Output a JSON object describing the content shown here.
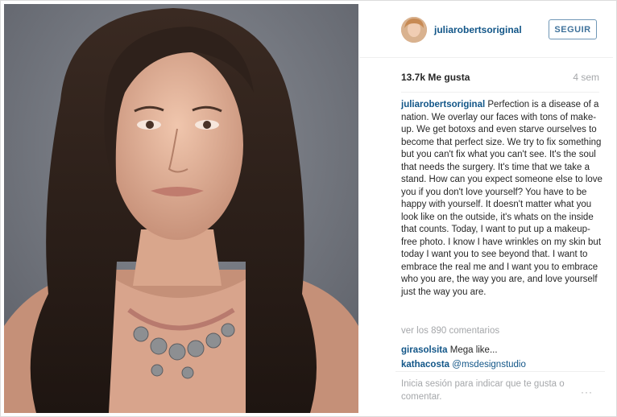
{
  "post": {
    "author": "juliarobertsoriginal",
    "follow_label": "SEGUIR",
    "likes": "13.7k Me gusta",
    "age": "4 sem",
    "caption_author": "juliarobertsoriginal",
    "caption_text": "Perfection is a disease of a nation. We overlay our faces with tons of make-up. We get botoxs and even starve ourselves to become that perfect size. We try to fix something but you can't fix what you can't see. It's the soul that needs the surgery. It's time that we take a stand. How can you expect someone else to love you if you don't love yourself? You have to be happy with yourself. It doesn't matter what you look like on the outside, it's whats on the inside that counts. Today, I want to put up a makeup-free photo. I know I have wrinkles on my skin but today I want you to see beyond that. I want to embrace the real me and I want you to embrace who you are, the way you are, and love yourself just the way you are.",
    "view_comments": "ver los 890 comentarios",
    "comments": [
      {
        "user": "girasolsita",
        "text": "Mega like..."
      },
      {
        "user": "kathacosta",
        "text": "@msdesignstudio"
      }
    ],
    "login_prompt": "Inicia sesión para indicar que te gusta o comentar.",
    "more_icon": "···"
  },
  "colors": {
    "link_blue": "#125688",
    "follow_blue": "#3f729b",
    "muted_gray": "#a5a7aa"
  }
}
